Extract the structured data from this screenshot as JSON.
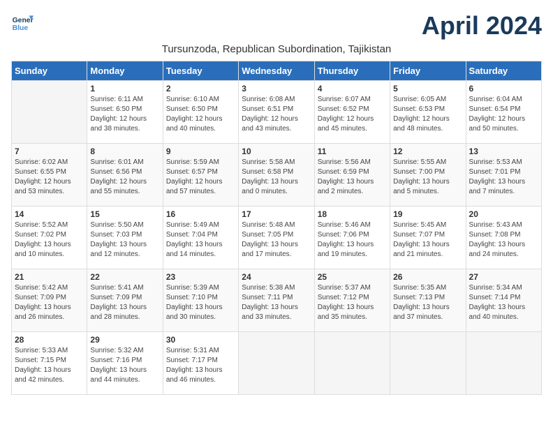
{
  "header": {
    "logo_line1": "General",
    "logo_line2": "Blue",
    "month_title": "April 2024",
    "subtitle": "Tursunzoda, Republican Subordination, Tajikistan"
  },
  "days_of_week": [
    "Sunday",
    "Monday",
    "Tuesday",
    "Wednesday",
    "Thursday",
    "Friday",
    "Saturday"
  ],
  "weeks": [
    [
      {
        "num": "",
        "info": ""
      },
      {
        "num": "1",
        "info": "Sunrise: 6:11 AM\nSunset: 6:50 PM\nDaylight: 12 hours\nand 38 minutes."
      },
      {
        "num": "2",
        "info": "Sunrise: 6:10 AM\nSunset: 6:50 PM\nDaylight: 12 hours\nand 40 minutes."
      },
      {
        "num": "3",
        "info": "Sunrise: 6:08 AM\nSunset: 6:51 PM\nDaylight: 12 hours\nand 43 minutes."
      },
      {
        "num": "4",
        "info": "Sunrise: 6:07 AM\nSunset: 6:52 PM\nDaylight: 12 hours\nand 45 minutes."
      },
      {
        "num": "5",
        "info": "Sunrise: 6:05 AM\nSunset: 6:53 PM\nDaylight: 12 hours\nand 48 minutes."
      },
      {
        "num": "6",
        "info": "Sunrise: 6:04 AM\nSunset: 6:54 PM\nDaylight: 12 hours\nand 50 minutes."
      }
    ],
    [
      {
        "num": "7",
        "info": "Sunrise: 6:02 AM\nSunset: 6:55 PM\nDaylight: 12 hours\nand 53 minutes."
      },
      {
        "num": "8",
        "info": "Sunrise: 6:01 AM\nSunset: 6:56 PM\nDaylight: 12 hours\nand 55 minutes."
      },
      {
        "num": "9",
        "info": "Sunrise: 5:59 AM\nSunset: 6:57 PM\nDaylight: 12 hours\nand 57 minutes."
      },
      {
        "num": "10",
        "info": "Sunrise: 5:58 AM\nSunset: 6:58 PM\nDaylight: 13 hours\nand 0 minutes."
      },
      {
        "num": "11",
        "info": "Sunrise: 5:56 AM\nSunset: 6:59 PM\nDaylight: 13 hours\nand 2 minutes."
      },
      {
        "num": "12",
        "info": "Sunrise: 5:55 AM\nSunset: 7:00 PM\nDaylight: 13 hours\nand 5 minutes."
      },
      {
        "num": "13",
        "info": "Sunrise: 5:53 AM\nSunset: 7:01 PM\nDaylight: 13 hours\nand 7 minutes."
      }
    ],
    [
      {
        "num": "14",
        "info": "Sunrise: 5:52 AM\nSunset: 7:02 PM\nDaylight: 13 hours\nand 10 minutes."
      },
      {
        "num": "15",
        "info": "Sunrise: 5:50 AM\nSunset: 7:03 PM\nDaylight: 13 hours\nand 12 minutes."
      },
      {
        "num": "16",
        "info": "Sunrise: 5:49 AM\nSunset: 7:04 PM\nDaylight: 13 hours\nand 14 minutes."
      },
      {
        "num": "17",
        "info": "Sunrise: 5:48 AM\nSunset: 7:05 PM\nDaylight: 13 hours\nand 17 minutes."
      },
      {
        "num": "18",
        "info": "Sunrise: 5:46 AM\nSunset: 7:06 PM\nDaylight: 13 hours\nand 19 minutes."
      },
      {
        "num": "19",
        "info": "Sunrise: 5:45 AM\nSunset: 7:07 PM\nDaylight: 13 hours\nand 21 minutes."
      },
      {
        "num": "20",
        "info": "Sunrise: 5:43 AM\nSunset: 7:08 PM\nDaylight: 13 hours\nand 24 minutes."
      }
    ],
    [
      {
        "num": "21",
        "info": "Sunrise: 5:42 AM\nSunset: 7:09 PM\nDaylight: 13 hours\nand 26 minutes."
      },
      {
        "num": "22",
        "info": "Sunrise: 5:41 AM\nSunset: 7:09 PM\nDaylight: 13 hours\nand 28 minutes."
      },
      {
        "num": "23",
        "info": "Sunrise: 5:39 AM\nSunset: 7:10 PM\nDaylight: 13 hours\nand 30 minutes."
      },
      {
        "num": "24",
        "info": "Sunrise: 5:38 AM\nSunset: 7:11 PM\nDaylight: 13 hours\nand 33 minutes."
      },
      {
        "num": "25",
        "info": "Sunrise: 5:37 AM\nSunset: 7:12 PM\nDaylight: 13 hours\nand 35 minutes."
      },
      {
        "num": "26",
        "info": "Sunrise: 5:35 AM\nSunset: 7:13 PM\nDaylight: 13 hours\nand 37 minutes."
      },
      {
        "num": "27",
        "info": "Sunrise: 5:34 AM\nSunset: 7:14 PM\nDaylight: 13 hours\nand 40 minutes."
      }
    ],
    [
      {
        "num": "28",
        "info": "Sunrise: 5:33 AM\nSunset: 7:15 PM\nDaylight: 13 hours\nand 42 minutes."
      },
      {
        "num": "29",
        "info": "Sunrise: 5:32 AM\nSunset: 7:16 PM\nDaylight: 13 hours\nand 44 minutes."
      },
      {
        "num": "30",
        "info": "Sunrise: 5:31 AM\nSunset: 7:17 PM\nDaylight: 13 hours\nand 46 minutes."
      },
      {
        "num": "",
        "info": ""
      },
      {
        "num": "",
        "info": ""
      },
      {
        "num": "",
        "info": ""
      },
      {
        "num": "",
        "info": ""
      }
    ]
  ]
}
